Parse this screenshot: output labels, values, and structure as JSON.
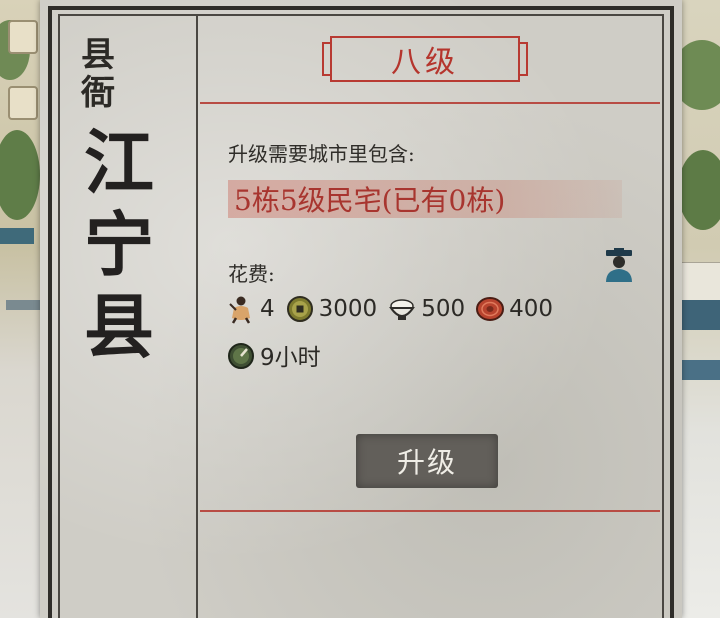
{
  "panel": {
    "office_label": "县衙",
    "county_name": "江宁县",
    "level": "八级",
    "requirement_label": "升级需要城市里包含:",
    "requirement_text": "5栋5级民宅(已有0栋)",
    "cost_label": "花费:",
    "costs": [
      {
        "icon": "worker-icon",
        "value": "4"
      },
      {
        "icon": "copper-coin-icon",
        "value": "3000"
      },
      {
        "icon": "rice-bowl-icon",
        "value": "500"
      },
      {
        "icon": "wood-log-icon",
        "value": "400"
      }
    ],
    "time": {
      "icon": "time-icon",
      "value": "9小时"
    },
    "upgrade_button": "升级"
  },
  "colors": {
    "accent_red": "#b5352d",
    "ink": "#2c2a26",
    "button_bg": "#625f5a"
  }
}
